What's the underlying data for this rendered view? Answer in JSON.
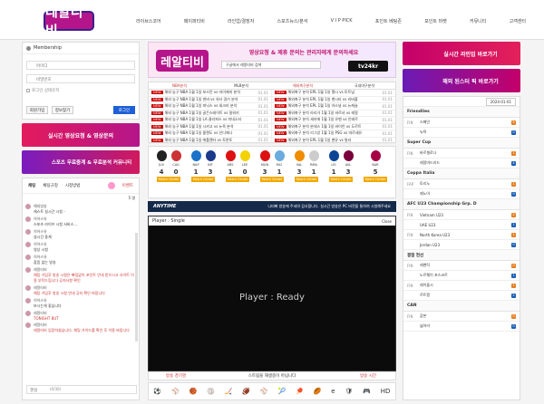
{
  "logo": "레알티비",
  "nav": [
    "라이브스코어",
    "페이퍼티비",
    "라인업/결장자",
    "스포츠뉴스/분석",
    "V I P PICK",
    "포인트 베팅존",
    "포인트 마켓",
    "커뮤니티",
    "고객센터"
  ],
  "membership": {
    "title": "Membership",
    "id_placeholder": "아이디",
    "pw_placeholder": "비밀번호",
    "keep": "로그인 상태유지",
    "join": "회원가입",
    "find": "정보찾기",
    "login": "로그인"
  },
  "left_banners": [
    "실시간 영상요청 & 영상문의",
    "스포츠 무료중계 & 무료분석 커뮤니티"
  ],
  "chat": {
    "tabs": [
      "채팅",
      "채팅규정",
      "시청방법"
    ],
    "count": "5 명",
    "events_label": "이벤트",
    "lines": [
      {
        "name": "해외방송",
        "msg": "캐스트 실시간 시청 -"
      },
      {
        "name": "히어스유",
        "msg": "스포츠 라이브 시청 서비스..."
      },
      {
        "name": "히어스유",
        "msg": "실시간 중계"
      },
      {
        "name": "히어스유",
        "msg": "영상 시청"
      },
      {
        "name": "히어스유",
        "msg": "잡음 없는 방송"
      },
      {
        "name": "레알티비",
        "msg": "채팅 가입후 방송 시청은 빠짐없이 포인트 안내 받으시고 사이트 이용 부탁드립니다 공지사항 확인"
      },
      {
        "name": "레알티비",
        "msg": "채팅 가입후 방송 시청 안내 공지 확인 바랍니다"
      },
      {
        "name": "히어스유",
        "msg": "보시는게 좋습니다"
      },
      {
        "name": "레알티비",
        "msg": "TONIGHT BUT"
      },
      {
        "name": "레알티비",
        "msg": "레알티비 입장하셨습니다. 채팅 가이드를 확인 후 이용 바랍니다"
      }
    ],
    "input_placeholder": "챈실",
    "send": "(0/30)"
  },
  "top_banner": {
    "brand": "레알티비",
    "title": "영상요청 & 제휴 문의는 관리자에게 문의하세요",
    "search_placeholder": "구글에서 레알티비 검색",
    "tv": "tv24kr"
  },
  "news": {
    "tabs": [
      "NBA분석",
      "MLB분석",
      "해외축구분석",
      "국내야구분석",
      "축구"
    ],
    "left": [
      "해외 농구 NBA 1월 1일 보스턴 vs 마이애미 분석",
      "해외 농구 NBA 1월 1일 덴버 vs 유타 경기 분석",
      "해외 농구 NBA 1월 1일 피닉스 vs 새크라 분석",
      "해외 농구 NBA 1월 1일 골든스테이트 vs 밀워키",
      "해외 농구 NBA 1월 1일 LA 클리퍼스 vs 미네소타",
      "해외 농구 NBA 1월 1일 시카고 vs 뉴욕 분석",
      "해외 농구 NBA 1월 1일 올랜도 vs 인디애나",
      "해외 농구 NBA 1월 1일 애틀랜타 vs 토론토"
    ],
    "right": [
      "해외축구 분석 EPL 1월 1일 첼시 vs 토트넘",
      "해외축구 분석 EPL 1월 1일 맨시티 vs 리버풀",
      "해외축구 분석 EPL 1월 1일 아스널 vs 뉴캐슬",
      "해외축구 분석 라리가 1월 1일 바르샤 vs 레알",
      "해외축구 분석 세리에 1월 1일 유벤 vs 인테르",
      "해외축구 분석 분데스 1월 1일 바이언 vs 도르트",
      "해외축구 분석 리그앙 1월 1일 PSG vs 마르세유",
      "해외축구 분석 EPL 1월 1일 맨유 vs 빌라"
    ],
    "dates": [
      "01.01",
      "01.01",
      "01.01",
      "01.01",
      "01.01",
      "01.01",
      "01.01",
      "01.01"
    ]
  },
  "scores": [
    {
      "teams": [
        "JUV",
        "CAG"
      ],
      "score": [
        "4",
        "0"
      ],
      "c": [
        "#222",
        "#c33"
      ]
    },
    {
      "teams": [
        "NAP",
        "INT"
      ],
      "score": [
        "1",
        "3"
      ],
      "c": [
        "#1a73c8",
        "#1b3a8c"
      ]
    },
    {
      "teams": [
        "ARS",
        "LEE"
      ],
      "score": [
        "1",
        "0"
      ],
      "c": [
        "#d11",
        "#f2d200"
      ]
    },
    {
      "teams": [
        "MUN",
        "MCI"
      ],
      "score": [
        "3",
        "1"
      ],
      "c": [
        "#d11",
        "#6cabdd"
      ]
    },
    {
      "teams": [
        "VAL",
        "RMA"
      ],
      "score": [
        "3",
        "1"
      ],
      "c": [
        "#f08c00",
        "#ccc"
      ]
    },
    {
      "teams": [
        "LEI",
        "AVL"
      ],
      "score": [
        "1",
        "3"
      ],
      "c": [
        "#0a4595",
        "#7a003c"
      ]
    },
    {
      "teams": [
        "BAR"
      ],
      "score": [
        "5"
      ],
      "c": [
        "#a50044"
      ]
    }
  ],
  "match_center": "Match Center",
  "notice_bar": {
    "anytime": "ANYTIME",
    "text": "니티빠 방송에 주셔야 감사합니다. 실시간 방송은 PC 버전을 통하여 시청해주세요"
  },
  "player": {
    "header": "Player : Single",
    "close": "Close",
    "ready": "Player : Ready",
    "under_left": "방송 경기명",
    "under_mid": "스트림을 재생중이 아닙니다",
    "under_right": "방송 시간"
  },
  "right_banners": [
    "실시간 라인업 바로가기",
    "해외 된스터 픽 바로가기"
  ],
  "score_list": {
    "date": "2024-01-01",
    "sections": [
      {
        "name": "Friendlies",
        "games": [
          {
            "st": "FIN",
            "t": [
              "스페인",
              "뉴욕"
            ],
            "s": [
              "4",
              "0"
            ]
          }
        ]
      },
      {
        "name": "Super Cup",
        "games": [
          {
            "st": "FIN",
            "t": [
              "바르셀로나",
              "레알마드리드"
            ],
            "s": [
              "1",
              "4"
            ]
          }
        ]
      },
      {
        "name": "Coppa Italia",
        "games": [
          {
            "st": "FAP",
            "t": [
              "토리노",
              "제노아"
            ],
            "s": [
              "1",
              "0"
            ]
          }
        ]
      },
      {
        "name": "AFC U23 Championship Grp. D",
        "games": [
          {
            "st": "FIN",
            "t": [
              "Vietnam U23",
              "UAE U23"
            ],
            "s": [
              "2",
              "1"
            ]
          },
          {
            "st": "FIN",
            "t": [
              "North Korea U23",
              "Jordan U23"
            ],
            "s": [
              "1",
              "0"
            ]
          }
        ]
      },
      {
        "name": "결점 현선",
        "games": [
          {
            "st": "FIN",
            "t": [
              "레벤틱",
              "노르웨이 포스코르"
            ],
            "s": [
              "0",
              "1"
            ]
          },
          {
            "st": "FIN",
            "t": [
              "레이돌시",
              "르트랭"
            ],
            "s": [
              "1",
              "2"
            ]
          }
        ]
      },
      {
        "name": "CAN",
        "games": [
          {
            "st": "FIN",
            "t": [
              "감본",
              "넓어라"
            ],
            "s": [
              "0",
              "0"
            ]
          }
        ]
      }
    ]
  },
  "sport_icons": [
    "⚽",
    "⚾",
    "🏀",
    "🏐",
    "🏒",
    "🏈",
    "⚾",
    "🎾",
    "🏓",
    "🏉",
    "e",
    "🛡",
    "🎮",
    "HD"
  ]
}
